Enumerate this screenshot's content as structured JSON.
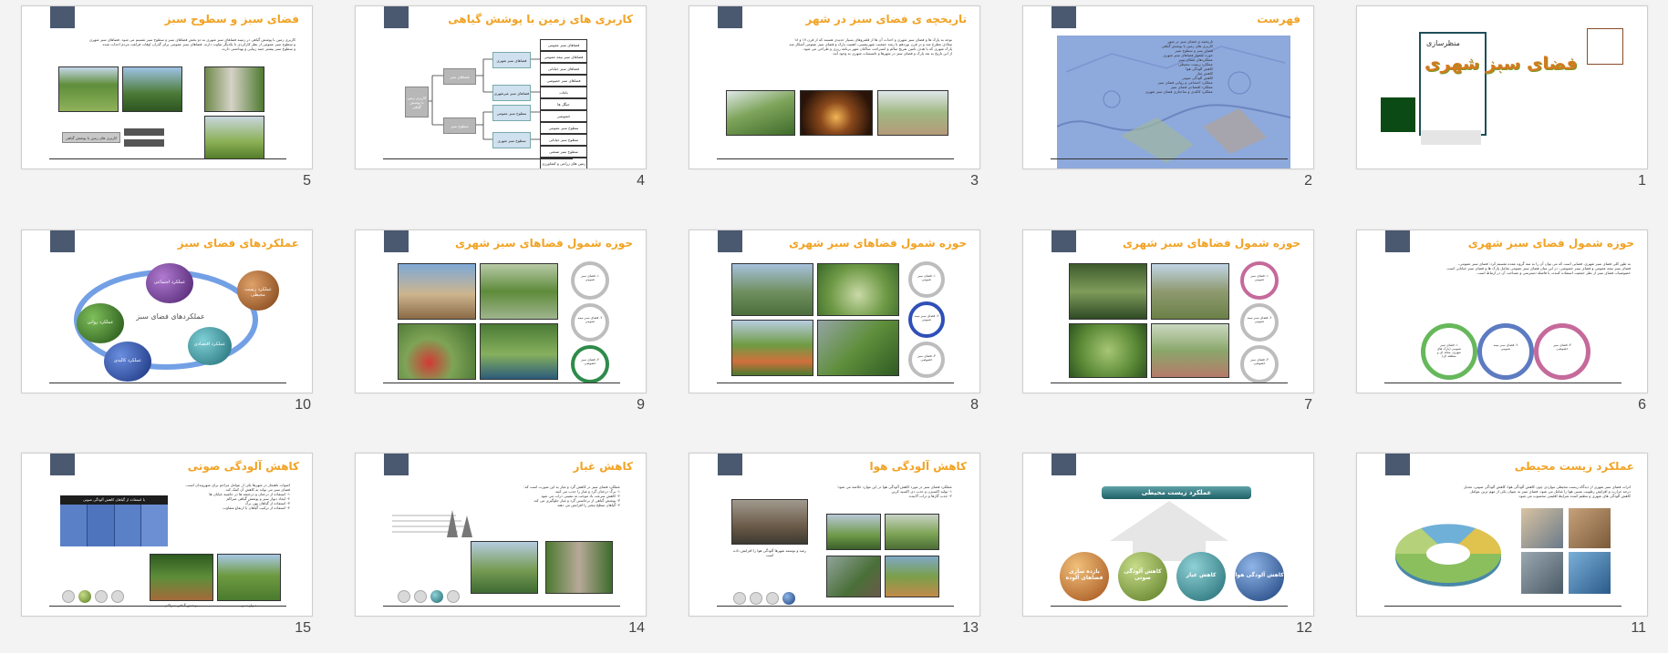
{
  "slides": [
    {
      "number": "1",
      "kicker": "منظرسازی",
      "title": "فضای سبز شهری"
    },
    {
      "number": "2",
      "title": "فهرست",
      "items": [
        "تاریخچه ی فضای سبز در شهر",
        "کاربری های زمین با پوشش گیاهی",
        "فضای سبز و سطوح سبز",
        "حوزه شمول فضاهای سبز شهری",
        "عملکردهای فضای سبز",
        "عملکرد زیست محیطی",
        "کاهش آلودگی هوا",
        "کاهش غبار",
        "کاهش آلودگی صوتی",
        "عملکرد اجتماعی و روانی فضای سبز",
        "عملکرد اقتصادی فضای سبز",
        "عملکرد کالبدی و ساختاری فضای سبز شهری"
      ]
    },
    {
      "number": "3",
      "title": "تاریخچه ی فضای سبز در شهر",
      "lines": [
        "توجه به پارک ها و فضای سبز شهری و احداث آن ها از قلمروهای بسیار جدیدی هستند که از قرن ۱۷ و ۱۸",
        "میلادی مطرح شد و در قرن نوزدهم با رشد جمعیت شهرنشینی، اهمیت پارک و فضای سبز عمومی آشکار شد",
        "پارک شهری که با هدف تامین تفریح سالم و استراحت ساکنان شهر برنامه ریزی و طراحی می شود.",
        "از این تاریخ به بعد پارک و فضای سبز در شهرها و تاسیسات شهری به وجود آمد."
      ]
    },
    {
      "number": "4",
      "title": "کاربری های زمین با پوشش گیاهی",
      "root": "کاربری زمین با پوشش گیاهی",
      "mid": [
        "فضاهای سبز",
        "سطوح سبز"
      ],
      "leaves": [
        "فضاهای سبز شهری",
        "فضاهای سبز غیرشهری",
        "سطوح سبز عمومی",
        "سطوح سبز شهری"
      ],
      "categories": [
        "فضاهای سبز عمومی",
        "فضاهای سبز نیمه عمومی",
        "فضاهای سبز خیابانی",
        "فضاهای سبز خصوصی",
        "باغات",
        "جنگل ها",
        "خصوصی",
        "سطوح سبز عمومی",
        "سطوح سبز خیابانی",
        "سطوح سبز صنعتی",
        "زمین های زراعی و کشاورزی"
      ]
    },
    {
      "number": "5",
      "title": "فضای سبز و سطوح سبز",
      "lines": [
        "کاربری زمین با پوشش گیاهی در زمینه فضاهای سبز شهری به دو بخش فضاهای سبز و سطوح سبز تقسیم می شود. فضاهای سبز شهری",
        "و سطوح سبز عمومی از نظر کارکردی با یکدیگر تفاوت دارند. فضاهای سبز عمومی برای گذران اوقات فراغت مردم احداث شده",
        "و سطوح سبز بیشتر جنبه زیبایی و بهداشتی دارند."
      ],
      "diagram_label": "کاربری های زمین با پوشش گیاهی"
    },
    {
      "number": "6",
      "title": "حوزه شمول فضای سبز شهری",
      "lines": [
        "به طور کلی فضای سبز شهری، فضایی است که می توان آن را به سه گروه عمده تقسیم کرد: فضای سبز عمومی،",
        "فضای سبز نیمه عمومی و فضای سبز خصوصی. در این میان فضای سبز عمومی شامل پارک ها و فضای سبز خیابانی است.",
        "خصوصیات فضای سبز از نظر جمعیت استفاده کننده، با فاصله دسترسی و مساحت آن در ارتباط است."
      ],
      "rings": [
        "۱- فضای سبز عمومی (پارک های شهری، محله ای و منطقه ای)",
        "۲- فضای سبز نیمه عمومی",
        "۳- فضای سبز خصوصی"
      ]
    },
    {
      "number": "7",
      "title": "حوزه شمول فضاهای سبز شهری",
      "rings": [
        "۱- فضای سبز عمومی",
        "۲- فضای سبز نیمه عمومی",
        "۳- فضای سبز خصوصی"
      ]
    },
    {
      "number": "8",
      "title": "حوزه شمول فضاهای سبز شهری",
      "rings": [
        "۱- فضای سبز عمومی",
        "۲- فضای سبز نیمه عمومی",
        "۳- فضای سبز خصوصی"
      ]
    },
    {
      "number": "9",
      "title": "حوزه شمول فضاهای سبز شهری",
      "rings": [
        "۱- فضای سبز عمومی",
        "۲- فضای سبز نیمه عمومی",
        "۳- فضای سبز خصوصی"
      ]
    },
    {
      "number": "10",
      "title": "عملکردهای فضای سبز",
      "center": "عملکردهای فضای سبز",
      "nodes": [
        "عملکرد زیست محیطی",
        "عملکرد اجتماعی",
        "عملکرد اقتصادی",
        "عملکرد کالبدی",
        "عملکرد روانی"
      ]
    },
    {
      "number": "11",
      "title": "عملکرد زیست محیطی",
      "lines": [
        "اثرات فضای سبز شهری از دیدگاه زیست محیطی مواردی چون کاهش آلودگی هوا، کاهش آلودگی صوتی، تعدیل",
        "درجه حرارت و افزایش رطوبت نسبی هوا را شامل می شود. فضای سبز به عنوان یکی از مهم ترین عوامل",
        "کاهش آلودگی های شهری و تنظیم کننده شرایط اقلیمی محسوب می شود."
      ]
    },
    {
      "number": "12",
      "title": "عملکرد زیست محیطی",
      "spheres": [
        "کاهش آلودگی هوا",
        "کاهش غبار",
        "کاهش آلودگی صوتی",
        "بازده سازی فضاهای آلوده"
      ]
    },
    {
      "number": "13",
      "title": "کاهش آلودگی هوا",
      "lines": [
        "عملکرد فضای سبز در مورد کاهش آلودگی هوا در این موارد خلاصه می شود:",
        "۱- تولید اکسیژن و جذب دی اکسید کربن",
        "۲- جذب گازها و ذرات آلاینده"
      ],
      "caption": "رشد و توسعه شهرها آلودگی هوا را افزایش داده است"
    },
    {
      "number": "14",
      "title": "کاهش غبار",
      "lines": [
        "عملکرد فضای سبز در کاهش گرد و غبار به این صورت است که:",
        "۱- برگ درختان گرد و غبار را جذب می کنند",
        "۲- کاهش سرعت باد موجب ته نشینی ذرات می شود",
        "۳- پوشش گیاهی از برخاستن گرد و غبار جلوگیری می کند",
        "۴- گیاهان سطح تبخیر را افزایش می دهند"
      ]
    },
    {
      "number": "15",
      "title": "کاهش آلودگی صوتی",
      "lines": [
        "اصوات ناهنجار در شهرها یکی از عوامل مزاحم برای شهروندان است. فضای سبز می تواند به کاهش آن کمک کند.",
        "۱- استفاده از درختان و درختچه ها در حاشیه خیابان ها",
        "۲- ایجاد دیوار سبز و پوشش گیاهی متراکم",
        "۳- استفاده از گیاهان پهن برگ",
        "۴- استفاده از ترکیب گیاهان با ارتفاع متفاوت"
      ],
      "table_title": "با استفاده از گیاهان کاهش آلودگی صوتی",
      "caption_left": "دیوار سبز",
      "caption_right": "پوشش گیاهی متراکم"
    }
  ]
}
